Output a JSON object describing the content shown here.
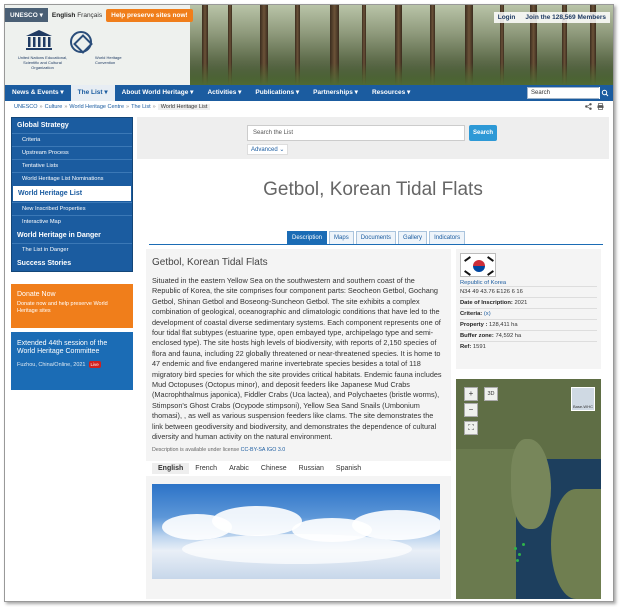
{
  "header": {
    "unesco_menu": "UNESCO ▾",
    "languages": [
      "English",
      "Français"
    ],
    "help_button": "Help preserve sites now!",
    "login": "Login",
    "join": "Join the 128,569 Members",
    "logo_left_text": "United Nations Educational, Scientific and Cultural Organization",
    "logo_right_text": "World Heritage Convention"
  },
  "nav": {
    "items": [
      "News & Events ▾",
      "The List ▾",
      "About World Heritage ▾",
      "Activities ▾",
      "Publications ▾",
      "Partnerships ▾",
      "Resources ▾"
    ],
    "search_placeholder": "Search"
  },
  "breadcrumb": [
    "UNESCO",
    "Culture",
    "World Heritage Centre",
    "The List",
    "World Heritage List"
  ],
  "sidebar": {
    "sections": [
      {
        "label": "Global Strategy",
        "type": "head"
      },
      {
        "label": "Criteria",
        "type": "sub"
      },
      {
        "label": "Upstream Process",
        "type": "sub"
      },
      {
        "label": "Tentative Lists",
        "type": "sub"
      },
      {
        "label": "World Heritage List Nominations",
        "type": "sub"
      },
      {
        "label": "World Heritage List",
        "type": "head-active"
      },
      {
        "label": "New Inscribed Properties",
        "type": "sub"
      },
      {
        "label": "Interactive Map",
        "type": "sub"
      },
      {
        "label": "World Heritage in Danger",
        "type": "head"
      },
      {
        "label": "The List in Danger",
        "type": "sub"
      },
      {
        "label": "Success Stories",
        "type": "head"
      }
    ],
    "donate_title": "Donate Now",
    "donate_text": "Donate now and help preserve World Heritage sites",
    "session_title": "Extended 44th session of the World Heritage Committee",
    "session_place": "Fuzhou, China/Online, 2021",
    "live": "Live"
  },
  "search": {
    "placeholder": "Search the List",
    "button": "Search",
    "advanced": "Advanced ⌄"
  },
  "page_title": "Getbol, Korean Tidal Flats",
  "tabs": [
    "Description",
    "Maps",
    "Documents",
    "Gallery",
    "Indicators"
  ],
  "content": {
    "title": "Getbol, Korean Tidal Flats",
    "text": "Situated in the eastern Yellow Sea on the southwestern and southern coast of the Republic of Korea, the site comprises four component parts: Seocheon Getbol, Gochang Getbol, Shinan Getbol and Boseong-Suncheon Getbol. The site exhibits a complex combination of geological, oceanographic and climatologic conditions that have led to the development of coastal diverse sedimentary systems. Each component represents one of four tidal flat subtypes (estuarine type, open embayed type, archipelago type and semi-enclosed type). The site hosts high levels of biodiversity, with reports of 2,150 species of flora and fauna, including 22 globally threatened or near-threatened species. It is home to 47 endemic and five endangered marine invertebrate species besides a total of 118 migratory bird species for which the site provides critical habitats. Endemic fauna includes Mud Octopuses (Octopus minor), and deposit feeders like Japanese Mud Crabs (Macrophthalmus japonica), Fiddler Crabs (Uca lactea), and Polychaetes (bristle worms), Stimpson's Ghost Crabs (Ocypode stimpsoni), Yellow Sea Sand Snails (Umbonium thomasi), , as well as various suspension feeders like clams. The site demonstrates the link between geodiversity and biodiversity, and demonstrates the dependence of cultural diversity and human activity on the natural environment.",
    "license_prefix": "Description is available under license",
    "license_link": "CC-BY-SA IGO 3.0",
    "languages": [
      "English",
      "French",
      "Arabic",
      "Chinese",
      "Russian",
      "Spanish"
    ]
  },
  "info": {
    "country": "Republic of Korea",
    "coordinates": "N34 49 43.76 E126 6 16",
    "date_label": "Date of Inscription:",
    "date_value": "2021",
    "criteria_label": "Criteria:",
    "criteria_value": "(x)",
    "property_label": "Property :",
    "property_value": "128,411 ha",
    "buffer_label": "Buffer zone:",
    "buffer_value": "74,592 ha",
    "ref_label": "Ref:",
    "ref_value": "1591"
  },
  "map": {
    "zoom_in": "+",
    "zoom_out": "−",
    "three_d": "3D",
    "basemap_label": "Base-WHC"
  },
  "colors": {
    "primary_blue": "#1b5ca0",
    "orange": "#f07e1b",
    "search_blue": "#2d99d6"
  }
}
